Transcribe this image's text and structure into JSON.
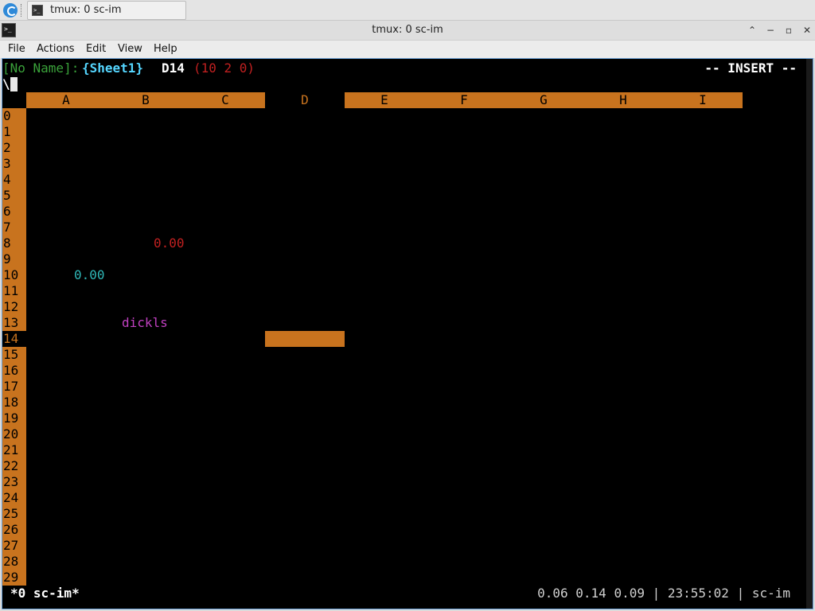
{
  "taskbar": {
    "launcher_icon": "app-launcher-icon",
    "task_label": "tmux: 0 sc-im",
    "task_icon_glyph": ">_"
  },
  "window": {
    "title": "tmux: 0 sc-im",
    "icon_glyph": ">_",
    "controls": {
      "shade": "⌃",
      "minimize": "−",
      "maximize": "▫",
      "close": "✕"
    }
  },
  "menu": [
    "File",
    "Actions",
    "Edit",
    "View",
    "Help"
  ],
  "scim": {
    "filename": "[No Name]:",
    "sheet": "{Sheet1}",
    "cell_ref": "D14",
    "cell_info": "(10 2 0)",
    "mode": "-- INSERT --",
    "input_line": "\\",
    "columns": [
      "A",
      "B",
      "C",
      "D",
      "E",
      "F",
      "G",
      "H",
      "I"
    ],
    "current_column": "D",
    "rows": [
      "0",
      "1",
      "2",
      "3",
      "4",
      "5",
      "6",
      "7",
      "8",
      "9",
      "10",
      "11",
      "12",
      "13",
      "14",
      "15",
      "16",
      "17",
      "18",
      "19",
      "20",
      "21",
      "22",
      "23",
      "24",
      "25",
      "26",
      "27",
      "28",
      "29"
    ],
    "current_row": "14",
    "cells": {
      "B8": "0.00",
      "A10": "0.00",
      "B13": "dickls"
    }
  },
  "tmux": {
    "left": "*0 sc-im*",
    "right": "0.06 0.14 0.09 | 23:55:02 | sc-im"
  },
  "colors": {
    "header_bg": "#c8731e",
    "terminal_bg": "#000000",
    "number_red": "#c02020",
    "number_cyan": "#2fb7b7",
    "text_magenta": "#c040c0",
    "filename_green": "#3aa23a",
    "sheet_cyan": "#55d6ff"
  }
}
